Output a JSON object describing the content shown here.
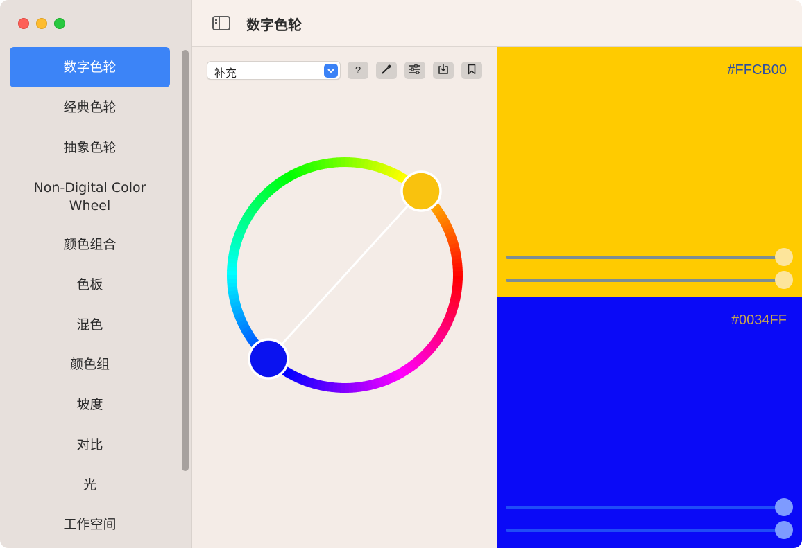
{
  "window": {
    "title": "数字色轮",
    "controls": [
      "close",
      "minimize",
      "zoom"
    ]
  },
  "sidebar": {
    "items": [
      {
        "label": "数字色轮",
        "active": true
      },
      {
        "label": "经典色轮",
        "active": false
      },
      {
        "label": "抽象色轮",
        "active": false
      },
      {
        "label": "Non-Digital Color\nWheel",
        "active": false
      },
      {
        "label": "颜色组合",
        "active": false
      },
      {
        "label": "色板",
        "active": false
      },
      {
        "label": "混色",
        "active": false
      },
      {
        "label": "颜色组",
        "active": false
      },
      {
        "label": "坡度",
        "active": false
      },
      {
        "label": "对比",
        "active": false
      },
      {
        "label": "光",
        "active": false
      },
      {
        "label": "工作空间",
        "active": false
      }
    ]
  },
  "toolbar": {
    "harmony_select": "补充",
    "buttons": [
      {
        "icon": "question-icon",
        "glyph": "?"
      },
      {
        "icon": "eyedropper-icon"
      },
      {
        "icon": "sliders-icon"
      },
      {
        "icon": "download-icon"
      },
      {
        "icon": "bookmark-icon"
      }
    ]
  },
  "swatches": [
    {
      "hex": "#FFCB00",
      "color": "#FFCB00",
      "sliders": [
        1.0,
        1.0
      ]
    },
    {
      "hex": "#0034FF",
      "color": "#0034FF",
      "sliders": [
        1.0,
        1.0
      ]
    }
  ],
  "colors": {
    "accent": "#3C84F7",
    "primary_swatch": "#FFCB00",
    "secondary_swatch": "#0034FF"
  }
}
